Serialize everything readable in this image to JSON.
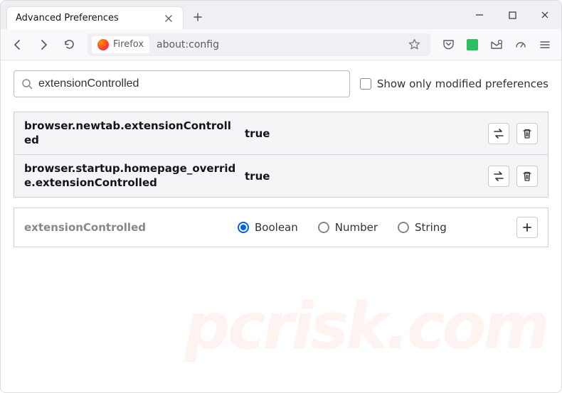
{
  "titlebar": {
    "tab_title": "Advanced Preferences"
  },
  "urlbar": {
    "identity_label": "Firefox",
    "url": "about:config"
  },
  "search": {
    "value": "extensionControlled",
    "modified_label": "Show only modified preferences"
  },
  "prefs": [
    {
      "name": "browser.newtab.extensionControlled",
      "value": "true"
    },
    {
      "name": "browser.startup.homepage_override.extensionControlled",
      "value": "true"
    }
  ],
  "new_pref": {
    "name": "extensionControlled",
    "types": [
      "Boolean",
      "Number",
      "String"
    ],
    "selected": 0
  },
  "watermark": "pcrisk.com"
}
